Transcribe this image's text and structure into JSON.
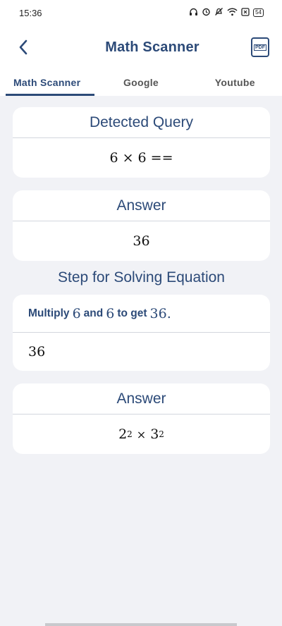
{
  "status": {
    "time": "15:36",
    "battery": "54"
  },
  "appbar": {
    "title": "Math Scanner",
    "pdf_label": "PDF"
  },
  "tabs": [
    "Math Scanner",
    "Google",
    "Youtube"
  ],
  "detected": {
    "title": "Detected Query",
    "value": "6 × 6 =="
  },
  "answer1": {
    "title": "Answer",
    "value": "36"
  },
  "steps_title": "Step for Solving Equation",
  "step": {
    "t1": "Multiply",
    "a": "6",
    "t2": "and",
    "b": "6",
    "t3": "to get",
    "r": "36",
    "t4": ".",
    "result": "36"
  },
  "answer2": {
    "title": "Answer",
    "base1": "2",
    "exp1": "2",
    "times": "×",
    "base2": "3",
    "exp2": "2"
  },
  "colors": {
    "accent": "#2c4a78",
    "background": "#f1f2f6"
  }
}
